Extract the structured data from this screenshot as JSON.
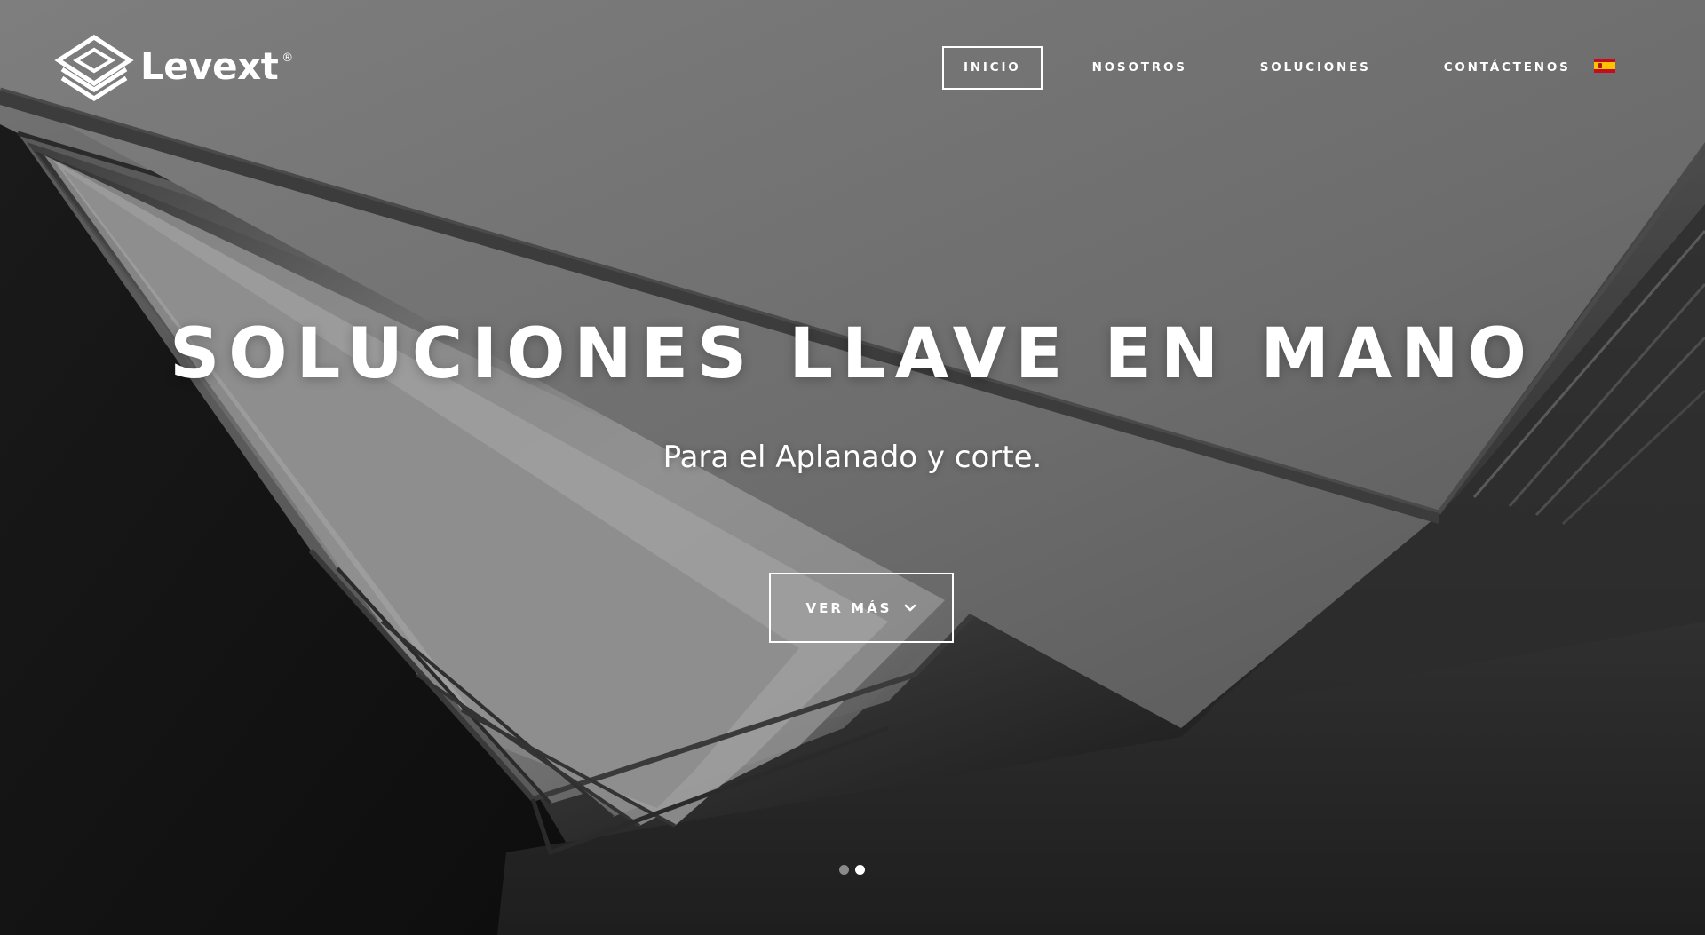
{
  "brand": {
    "name": "Levext",
    "registered_mark": "®"
  },
  "nav": {
    "items": [
      {
        "label": "INICIO",
        "active": true
      },
      {
        "label": "NOSOTROS",
        "active": false
      },
      {
        "label": "SOLUCIONES",
        "active": false
      },
      {
        "label": "CONTÁCTENOS",
        "active": false
      }
    ],
    "language_flag_icon": "spain-flag-icon"
  },
  "hero": {
    "title": "SOLUCIONES LLAVE EN MANO",
    "subtitle": "Para el Aplanado y corte.",
    "cta_label": "VER MÁS",
    "cta_icon": "chevron-down-icon"
  },
  "slider": {
    "slide_count": 2,
    "active_slide": 2
  },
  "colors": {
    "text": "#ffffff",
    "flag_red": "#c60b1e",
    "flag_yellow": "#ffc400"
  }
}
